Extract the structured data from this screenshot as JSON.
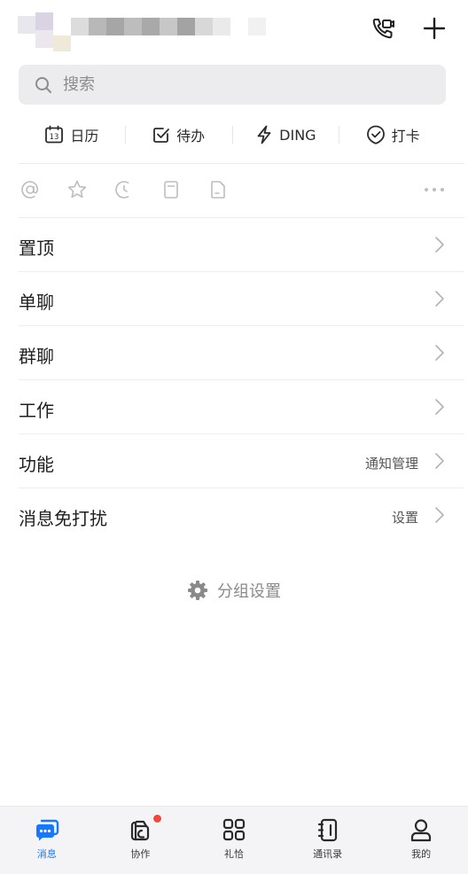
{
  "header": {
    "icons": [
      "phone-call-icon",
      "plus-icon"
    ]
  },
  "search": {
    "placeholder": "搜索"
  },
  "quick_actions": [
    {
      "label": "日历",
      "icon": "calendar-icon",
      "day": "13"
    },
    {
      "label": "待办",
      "icon": "todo-check-icon"
    },
    {
      "label": "DING",
      "icon": "lightning-icon"
    },
    {
      "label": "打卡",
      "icon": "checkin-icon"
    }
  ],
  "filter_icons": [
    "at-icon",
    "star-icon",
    "moon-icon",
    "bookmark-icon",
    "document-icon",
    "more-icon"
  ],
  "list": [
    {
      "label": "置顶",
      "value": ""
    },
    {
      "label": "单聊",
      "value": ""
    },
    {
      "label": "群聊",
      "value": ""
    },
    {
      "label": "工作",
      "value": ""
    },
    {
      "label": "功能",
      "value": "通知管理"
    },
    {
      "label": "消息免打扰",
      "value": "设置"
    }
  ],
  "group_settings": {
    "label": "分组设置"
  },
  "tabbar": {
    "active": 0,
    "accent": "#1677ff",
    "badge_color": "#f5463a",
    "items": [
      {
        "label": "消息",
        "icon": "message-icon"
      },
      {
        "label": "协作",
        "icon": "collab-icon",
        "badge": true
      },
      {
        "label": "礼恰",
        "icon": "apps-grid-icon"
      },
      {
        "label": "通讯录",
        "icon": "contacts-icon"
      },
      {
        "label": "我的",
        "icon": "profile-icon"
      }
    ]
  }
}
